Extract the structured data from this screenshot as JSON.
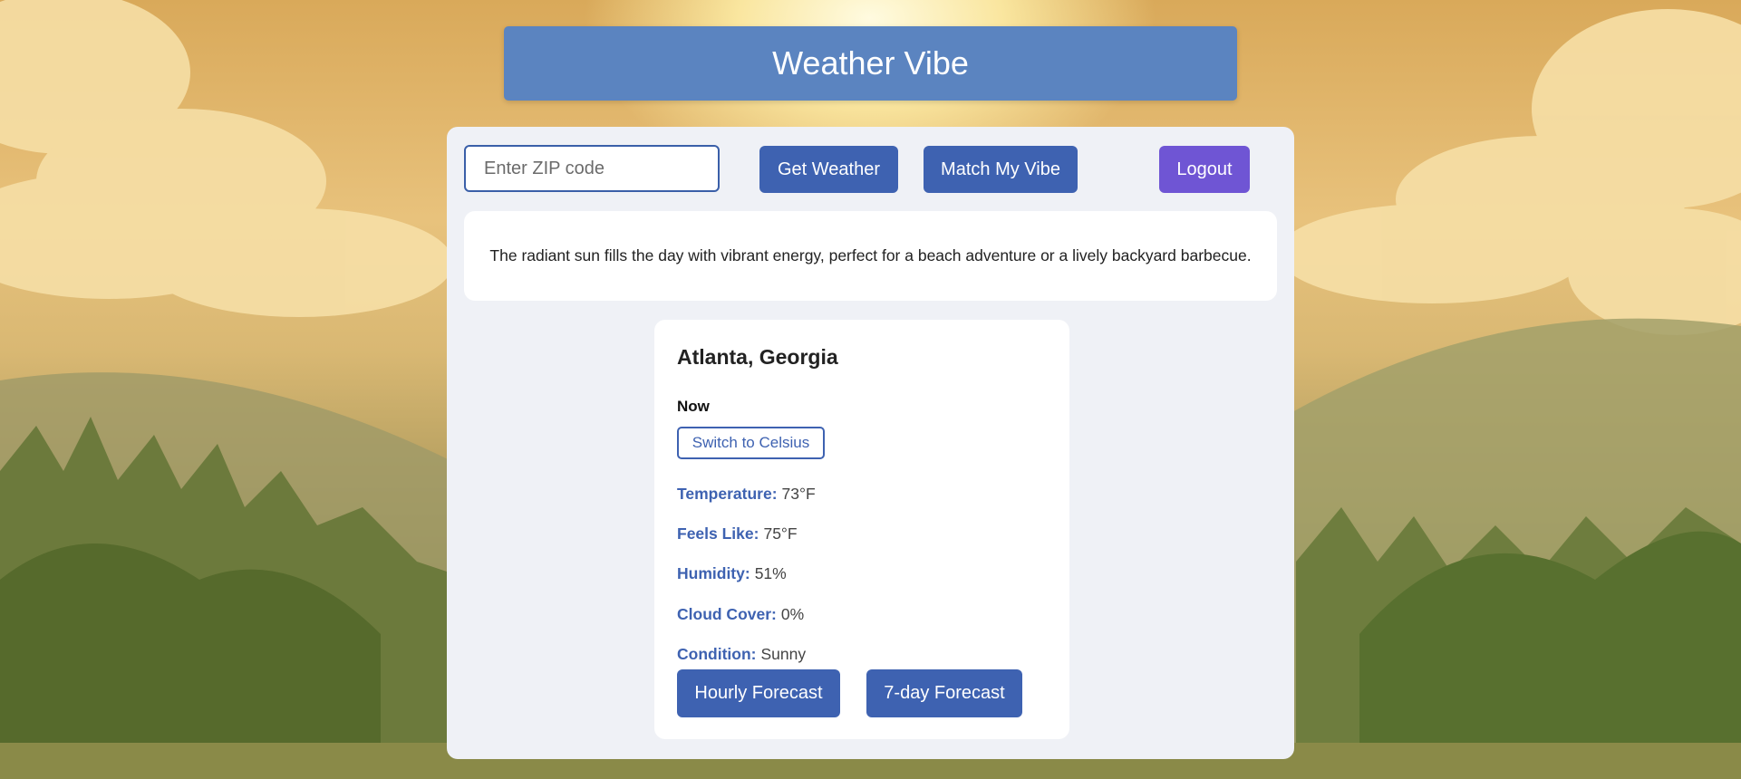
{
  "header": {
    "title": "Weather Vibe"
  },
  "toolbar": {
    "zip_placeholder": "Enter ZIP code",
    "zip_value": "",
    "get_weather_label": "Get Weather",
    "match_vibe_label": "Match My Vibe",
    "logout_label": "Logout"
  },
  "vibe": {
    "text": "The radiant sun fills the day with vibrant energy, perfect for a beach adventure or a lively backyard barbecue."
  },
  "weather": {
    "location": "Atlanta, Georgia",
    "period": "Now",
    "unit_toggle_label": "Switch to Celsius",
    "rows": [
      {
        "label": "Temperature:",
        "value": "73°F"
      },
      {
        "label": "Feels Like:",
        "value": "75°F"
      },
      {
        "label": "Humidity:",
        "value": "51%"
      },
      {
        "label": "Cloud Cover:",
        "value": "0%"
      },
      {
        "label": "Condition:",
        "value": "Sunny"
      }
    ],
    "hourly_label": "Hourly Forecast",
    "weekly_label": "7-day Forecast"
  },
  "colors": {
    "header_bg": "#5b84c0",
    "primary": "#3e62b1",
    "logout": "#6f55d4",
    "panel_bg": "#eff1f6"
  }
}
